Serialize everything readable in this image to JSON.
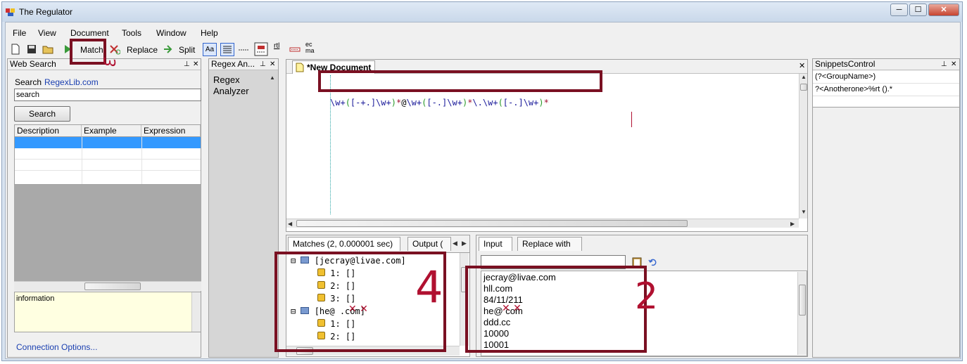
{
  "window": {
    "title": "The Regulator",
    "min": "─",
    "max": "☐",
    "close": "✕"
  },
  "menu": [
    "File",
    "View",
    "Document",
    "Tools",
    "Window",
    "Help"
  ],
  "toolbar": {
    "match": "Match",
    "replace": "Replace",
    "split": "Split",
    "aa": "Aa",
    "rtl": "rtl",
    "ecma_top": "ec",
    "ecma_bottom": "ma"
  },
  "web_search": {
    "header": "Web Search",
    "search_label": "Search",
    "site_link": "RegexLib.com",
    "input_value": "search",
    "button": "Search",
    "columns": [
      "Description",
      "Example",
      "Expression"
    ],
    "info_text": "information",
    "connection_link": "Connection Options..."
  },
  "regex_analyzer": {
    "header": "Regex An...",
    "body_line1": "Regex",
    "body_line2": "Analyzer"
  },
  "editor": {
    "tab_title": "*New Document",
    "tokens": [
      {
        "t": "\\w+",
        "c": "e"
      },
      {
        "t": "(",
        "c": "g"
      },
      {
        "t": "[-+.]",
        "c": "e"
      },
      {
        "t": "\\w+",
        "c": "e"
      },
      {
        "t": ")",
        "c": "g"
      },
      {
        "t": "*",
        "c": "r"
      },
      {
        "t": "@",
        "c": "n"
      },
      {
        "t": "\\w+",
        "c": "e"
      },
      {
        "t": "(",
        "c": "g"
      },
      {
        "t": "[-.]",
        "c": "e"
      },
      {
        "t": "\\w+",
        "c": "e"
      },
      {
        "t": ")",
        "c": "g"
      },
      {
        "t": "*",
        "c": "r"
      },
      {
        "t": "\\.",
        "c": "e"
      },
      {
        "t": "\\w+",
        "c": "e"
      },
      {
        "t": "(",
        "c": "g"
      },
      {
        "t": "[-.]",
        "c": "e"
      },
      {
        "t": "\\w+",
        "c": "e"
      },
      {
        "t": ")",
        "c": "g"
      },
      {
        "t": "*",
        "c": "r"
      }
    ]
  },
  "results": {
    "tab_matches": "Matches (2, 0.000001 sec)",
    "tab_output": "Output (",
    "tree": [
      {
        "label": "[jecray@livae.com]",
        "groups": [
          "1:  []",
          "2:  []",
          "3:  []"
        ]
      },
      {
        "label": "[he@      .com]",
        "groups": [
          "1:  []",
          "2:  []"
        ]
      }
    ]
  },
  "input_panel": {
    "tab_input": "Input",
    "tab_replace": "Replace with",
    "lines": [
      "jecray@livae.com",
      "hll.com",
      "84/11/211",
      "he@       com",
      "ddd.cc",
      "10000",
      "10001"
    ]
  },
  "snippets": {
    "header": "SnippetsControl",
    "items": [
      "(?<GroupName>)",
      "?<Anotherone>%rt ().*"
    ]
  },
  "annotations": {
    "n1": "3",
    "n2": "2",
    "n4": "4"
  },
  "colors": {
    "annotation_box": "#7a1022",
    "handwriting": "#b01030",
    "selection": "#3399ff",
    "info_bg": "#ffffe1"
  }
}
